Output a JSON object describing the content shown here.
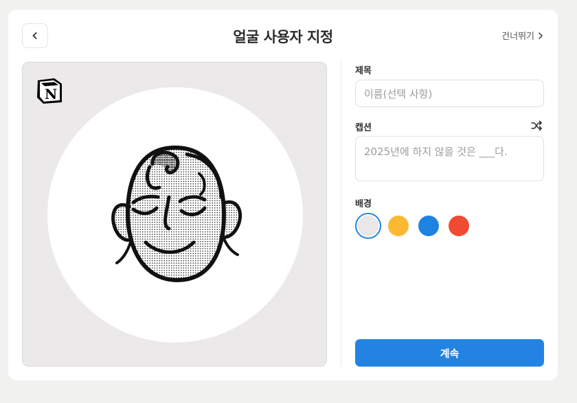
{
  "header": {
    "title": "얼굴 사용자 지정",
    "skip_label": "건너뛰기"
  },
  "form": {
    "title_label": "제목",
    "title_placeholder": "이름(선택 사항)",
    "caption_label": "캡션",
    "caption_placeholder": "2025년에 하지 않을 것은 ___다.",
    "background_label": "배경",
    "background_colors": [
      {
        "name": "gray",
        "hex": "#e9e7e7",
        "selected": true
      },
      {
        "name": "yellow",
        "hex": "#fbb832",
        "selected": false
      },
      {
        "name": "blue",
        "hex": "#1e82e1",
        "selected": false
      },
      {
        "name": "red",
        "hex": "#f04b32",
        "selected": false
      }
    ]
  },
  "continue_label": "계속",
  "icons": {
    "back": "chevron-left-icon",
    "skip": "chevron-right-icon",
    "shuffle": "shuffle-icon",
    "logo": "notion-logo"
  },
  "colors": {
    "accent": "#2383e2",
    "preview_bg": "#ebe9e9"
  }
}
